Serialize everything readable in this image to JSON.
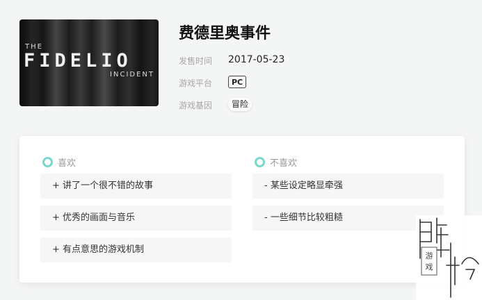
{
  "game": {
    "cover": {
      "line1": "THE",
      "line2": "FIDELIO",
      "line3": "INCIDENT"
    },
    "title": "费德里奥事件",
    "release_label": "发售时间",
    "release_date": "2017-05-23",
    "platform_label": "游戏平台",
    "platform": "PC",
    "genre_label": "游戏基因",
    "genre": "冒险"
  },
  "review": {
    "likes_label": "喜欢",
    "likes": [
      "+ 讲了一个很不错的故事",
      "+ 优秀的画面与音乐",
      "+ 有点意思的游戏机制"
    ],
    "dislikes_label": "不喜欢",
    "dislikes": [
      "- 某些设定略显牵强",
      "- 一些细节比较粗糙"
    ]
  },
  "watermark": {
    "sub_text": "游戏"
  },
  "colors": {
    "accent": "#78d8cb",
    "item_bg": "#f6f6f6",
    "page_bg": "#f4f5f5"
  }
}
